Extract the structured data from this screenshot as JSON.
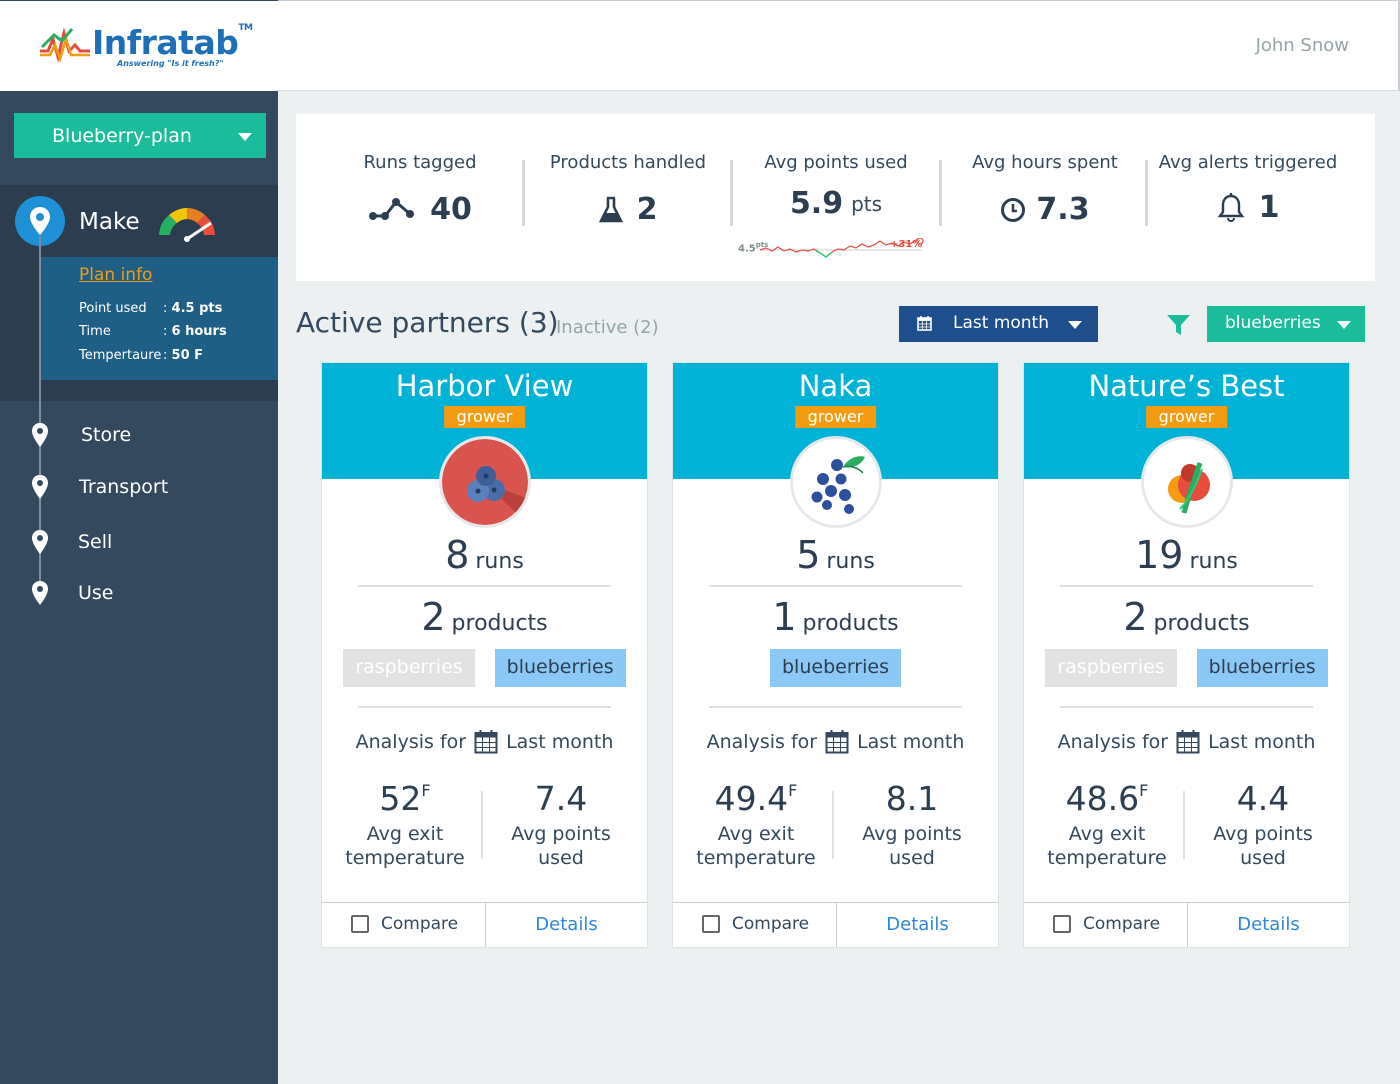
{
  "brand": {
    "name": "Infratab",
    "tagline": "Answering \"Is it fresh?\"",
    "trademark": "TM"
  },
  "header": {
    "user_name": "John Snow"
  },
  "sidebar": {
    "plan_select": "Blueberry-plan",
    "active_stage": {
      "label": "Make",
      "plan_info_link": "Plan info",
      "rows": [
        {
          "key": "Point used",
          "sep": ":",
          "value": "4.5 pts"
        },
        {
          "key": "Time",
          "sep": ":",
          "value": "6 hours"
        },
        {
          "key": "Tempertaure",
          "sep": ":",
          "value": "50 F"
        }
      ]
    },
    "stages": [
      {
        "label": "Store"
      },
      {
        "label": "Transport"
      },
      {
        "label": "Sell"
      },
      {
        "label": "Use"
      }
    ]
  },
  "stats": {
    "runs_tagged": {
      "title": "Runs tagged",
      "value": "40",
      "icon": "nodes-icon"
    },
    "products_handled": {
      "title": "Products handled",
      "value": "2",
      "icon": "flask-icon"
    },
    "avg_points": {
      "title": "Avg points used",
      "value": "5.9",
      "unit": "pts",
      "spark_start": "4.5",
      "spark_start_unit": "pts",
      "spark_change": "+31%"
    },
    "avg_hours": {
      "title": "Avg hours spent",
      "value": "7.3",
      "icon": "clock-icon"
    },
    "avg_alerts": {
      "title": "Avg alerts triggered",
      "value": "1",
      "icon": "bell-icon"
    }
  },
  "partners": {
    "title": "Active partners (3)",
    "inactive": "Inactive (2)",
    "time_filter": "Last month",
    "fruit_filter": "blueberries",
    "cards": [
      {
        "name": "Harbor View",
        "badge": "grower",
        "runs": "8",
        "runs_word": "runs",
        "products": "2",
        "products_word": "products",
        "tags": [
          {
            "label": "raspberries",
            "active": false
          },
          {
            "label": "blueberries",
            "active": true
          }
        ],
        "analysis_prefix": "Analysis for",
        "analysis_period": "Last month",
        "temp": "52",
        "temp_unit": "F",
        "temp_label_1": "Avg exit",
        "temp_label_2": "temperature",
        "points": "7.4",
        "points_label_1": "Avg points",
        "points_label_2": "used",
        "compare": "Compare",
        "details": "Details"
      },
      {
        "name": "Naka",
        "badge": "grower",
        "runs": "5",
        "runs_word": "runs",
        "products": "1",
        "products_word": "products",
        "tags": [
          {
            "label": "blueberries",
            "active": true
          }
        ],
        "analysis_prefix": "Analysis for",
        "analysis_period": "Last month",
        "temp": "49.4",
        "temp_unit": "F",
        "temp_label_1": "Avg exit",
        "temp_label_2": "temperature",
        "points": "8.1",
        "points_label_1": "Avg points",
        "points_label_2": "used",
        "compare": "Compare",
        "details": "Details"
      },
      {
        "name": "Nature’s Best",
        "badge": "grower",
        "runs": "19",
        "runs_word": "runs",
        "products": "2",
        "products_word": "products",
        "tags": [
          {
            "label": "raspberries",
            "active": false
          },
          {
            "label": "blueberries",
            "active": true
          }
        ],
        "analysis_prefix": "Analysis for",
        "analysis_period": "Last month",
        "temp": "48.6",
        "temp_unit": "F",
        "temp_label_1": "Avg exit",
        "temp_label_2": "temperature",
        "points": "4.4",
        "points_label_1": "Avg points",
        "points_label_2": "used",
        "compare": "Compare",
        "details": "Details"
      }
    ]
  },
  "colors": {
    "teal": "#1abc9c",
    "navy": "#1f4e8c",
    "cyan": "#00b3d6",
    "orange": "#f39c12",
    "sidebar": "#34495e"
  }
}
